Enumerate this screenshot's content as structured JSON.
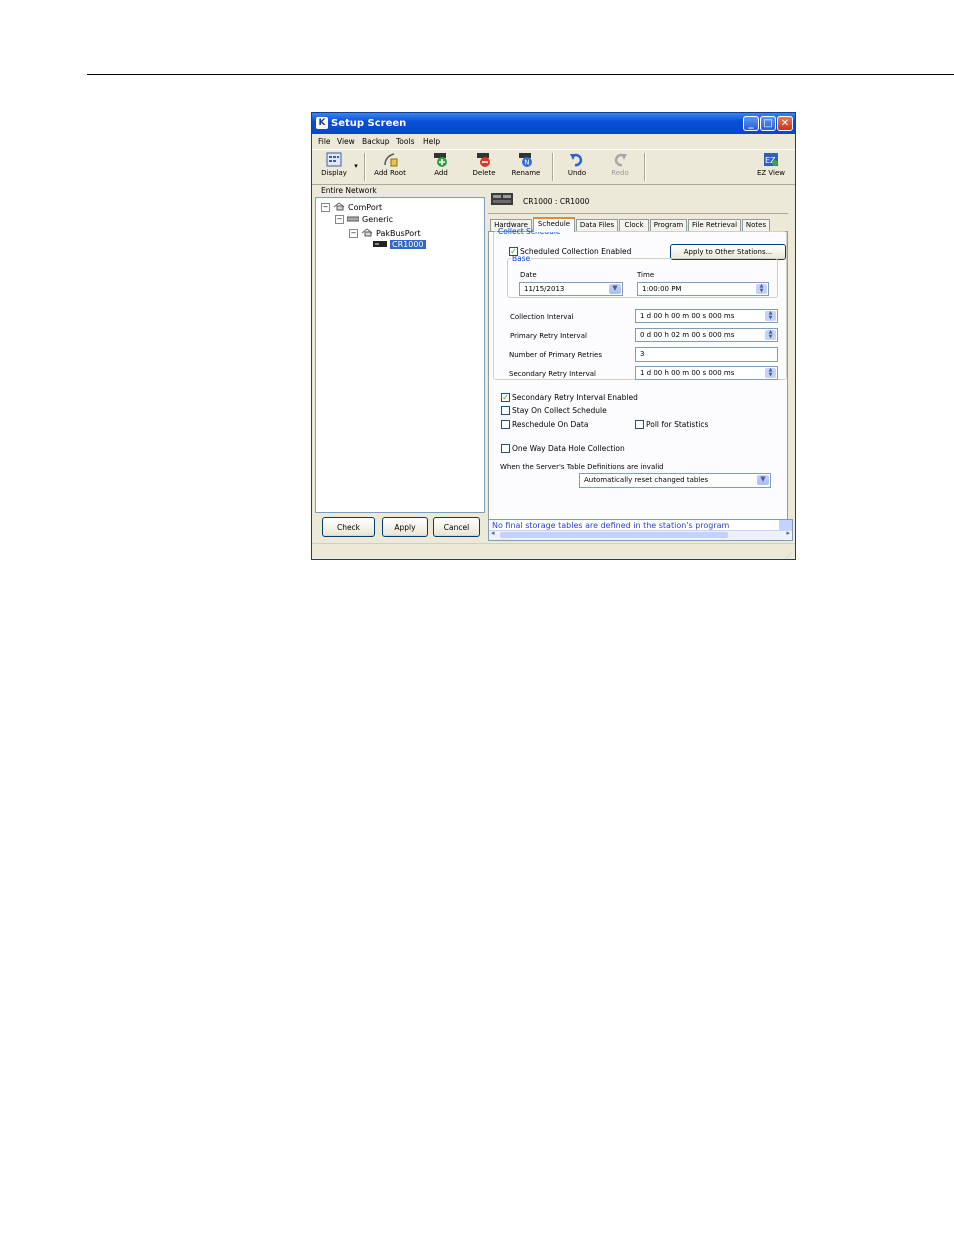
{
  "window": {
    "title": "Setup Screen",
    "app_icon": "K"
  },
  "menu": [
    "File",
    "View",
    "Backup",
    "Tools",
    "Help"
  ],
  "toolbar": {
    "display": "Display",
    "add_root": "Add Root",
    "add": "Add",
    "delete": "Delete",
    "rename": "Rename",
    "undo": "Undo",
    "redo": "Redo",
    "ez_view": "EZ View"
  },
  "tree": {
    "header": "Entire Network",
    "nodes": [
      "ComPort",
      "Generic",
      "PakBusPort",
      "CR1000"
    ]
  },
  "left_buttons": {
    "check": "Check",
    "apply": "Apply",
    "cancel": "Cancel"
  },
  "device": {
    "title": "CR1000 : CR1000"
  },
  "tabs": [
    "Hardware",
    "Schedule",
    "Data Files",
    "Clock",
    "Program",
    "File Retrieval",
    "Notes"
  ],
  "schedule": {
    "group_label": "Collect Schedule",
    "scheduled_enabled_label": "Scheduled Collection Enabled",
    "apply_other_label": "Apply to Other Stations...",
    "base_label": "Base",
    "date_label": "Date",
    "date_value": "11/15/2013",
    "time_label": "Time",
    "time_value": "1:00:00 PM",
    "collection_interval_label": "Collection Interval",
    "collection_interval_value": "1 d 00 h 00 m 00 s 000 ms",
    "primary_retry_label": "Primary Retry Interval",
    "primary_retry_value": "0 d 00 h 02 m 00 s 000 ms",
    "num_primary_retries_label": "Number of Primary Retries",
    "num_primary_retries_value": "3",
    "secondary_retry_label": "Secondary Retry Interval",
    "secondary_retry_value": "1 d 00 h 00 m 00 s 000 ms",
    "secondary_enabled_label": "Secondary Retry Interval Enabled",
    "stay_on_label": "Stay On Collect Schedule",
    "reschedule_label": "Reschedule On Data",
    "poll_stats_label": "Poll for Statistics",
    "one_way_label": "One Way Data Hole Collection",
    "table_def_label": "When the Server's Table Definitions are invalid",
    "table_def_value": "Automatically reset changed tables"
  },
  "status_message": "No final storage tables are defined in the station's program",
  "colors": {
    "title_bar": "#0a4fd6",
    "selection": "#316ac5",
    "status_text": "#2a3fd8",
    "group_label": "#0046d5"
  }
}
